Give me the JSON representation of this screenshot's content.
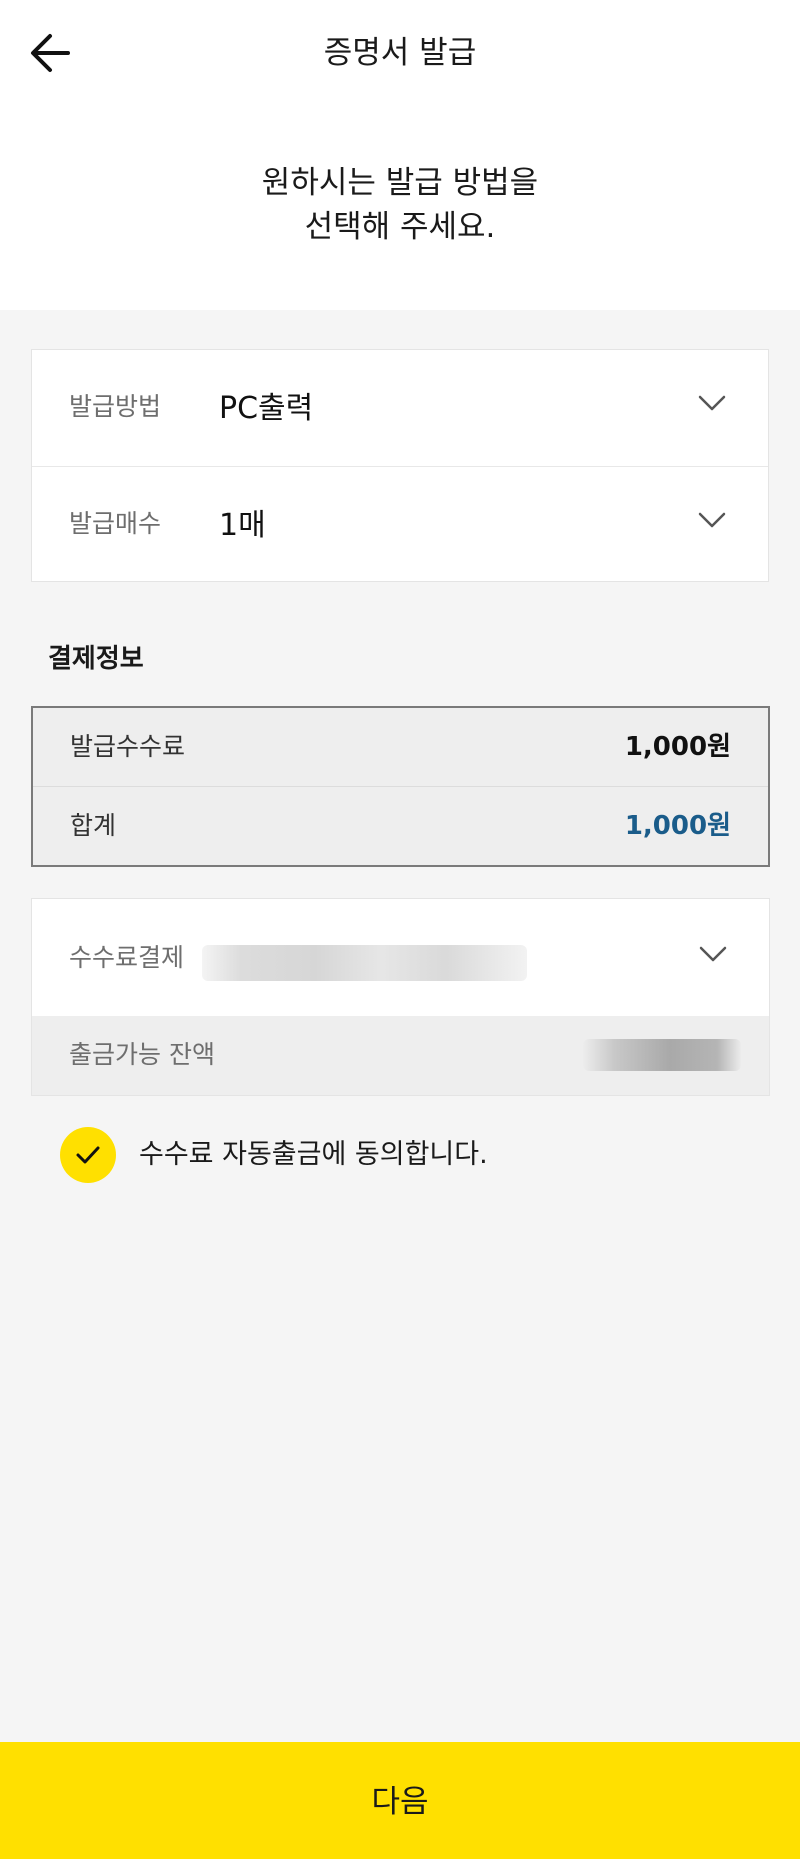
{
  "header": {
    "title": "증명서 발급",
    "back_icon": "arrow-left-icon"
  },
  "intro": {
    "line1": "원하시는 발급 방법을",
    "line2": "선택해 주세요."
  },
  "issue_options": {
    "method": {
      "label": "발급방법",
      "value": "PC출력",
      "icon": "chevron-down-icon"
    },
    "copies": {
      "label": "발급매수",
      "value": "1매",
      "icon": "chevron-down-icon"
    }
  },
  "payment_info": {
    "title": "결제정보",
    "fee": {
      "label": "발급수수료",
      "amount": "1,000원"
    },
    "total": {
      "label": "합계",
      "amount": "1,000원"
    }
  },
  "fee_payment": {
    "label": "수수료결제",
    "icon": "chevron-down-icon",
    "balance_label": "출금가능 잔액"
  },
  "agreement": {
    "text": "수수료 자동출금에 동의합니다.",
    "checked": true,
    "icon": "check-icon"
  },
  "next_button": {
    "label": "다음"
  },
  "colors": {
    "accent": "#ffe000",
    "total_amount": "#1a5c8a",
    "background": "#f5f5f5"
  }
}
